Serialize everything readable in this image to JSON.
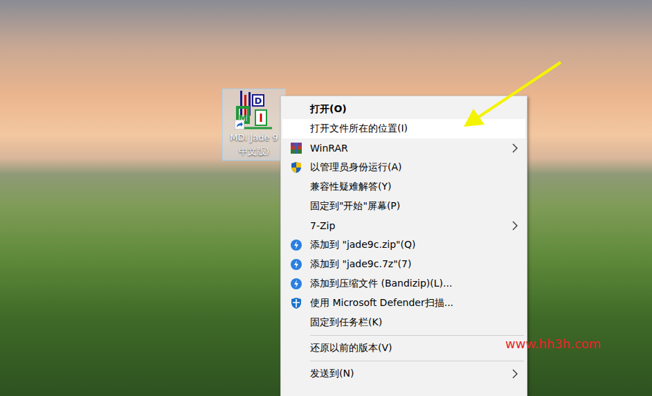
{
  "desktop": {
    "icon": {
      "logo_letters": [
        "M",
        "D",
        "I"
      ],
      "label_lines": [
        "MDI Jade 9",
        "中文版)"
      ],
      "selected": true
    }
  },
  "context_menu": {
    "items": [
      {
        "kind": "item",
        "label": "打开(O)",
        "bold": true,
        "selected": false,
        "submenu": false
      },
      {
        "kind": "item",
        "label": "打开文件所在的位置(I)",
        "bold": false,
        "selected": true,
        "submenu": false
      },
      {
        "kind": "item",
        "label": "WinRAR",
        "bold": false,
        "selected": false,
        "submenu": true
      },
      {
        "kind": "item",
        "label": "以管理员身份运行(A)",
        "bold": false,
        "selected": false,
        "submenu": false
      },
      {
        "kind": "item",
        "label": "兼容性疑难解答(Y)",
        "bold": false,
        "selected": false,
        "submenu": false
      },
      {
        "kind": "item",
        "label": "固定到\"开始\"屏幕(P)",
        "bold": false,
        "selected": false,
        "submenu": false
      },
      {
        "kind": "item",
        "label": "7-Zip",
        "bold": false,
        "selected": false,
        "submenu": true
      },
      {
        "kind": "item",
        "label": "添加到 \"jade9c.zip\"(Q)",
        "bold": false,
        "selected": false,
        "submenu": false
      },
      {
        "kind": "item",
        "label": "添加到 \"jade9c.7z\"(7)",
        "bold": false,
        "selected": false,
        "submenu": false
      },
      {
        "kind": "item",
        "label": "添加到压缩文件 (Bandizip)(L)...",
        "bold": false,
        "selected": false,
        "submenu": false
      },
      {
        "kind": "item",
        "label": "使用 Microsoft Defender扫描...",
        "bold": false,
        "selected": false,
        "submenu": false
      },
      {
        "kind": "item",
        "label": "固定到任务栏(K)",
        "bold": false,
        "selected": false,
        "submenu": false
      },
      {
        "kind": "separator"
      },
      {
        "kind": "item",
        "label": "还原以前的版本(V)",
        "bold": false,
        "selected": false,
        "submenu": false
      },
      {
        "kind": "separator"
      },
      {
        "kind": "item",
        "label": "发送到(N)",
        "bold": false,
        "selected": false,
        "submenu": true
      }
    ]
  },
  "watermark": "www.hh3h.com"
}
